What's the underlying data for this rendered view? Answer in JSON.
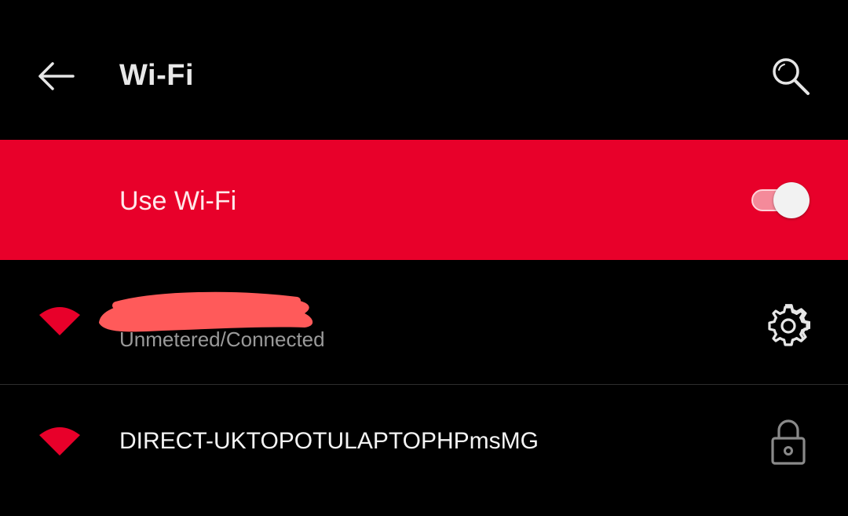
{
  "header": {
    "title": "Wi-Fi",
    "back_icon": "arrow-left-icon",
    "search_icon": "search-icon"
  },
  "master_switch": {
    "label": "Use Wi-Fi",
    "enabled": true
  },
  "networks": [
    {
      "name": "",
      "name_redacted": true,
      "status": "Unmetered/Connected",
      "signal_icon": "wifi-signal-icon",
      "action_icon": "gear-icon",
      "connected": true
    },
    {
      "name": "DIRECT-UKTOPOTULAPTOPHPmsMG",
      "status": "",
      "signal_icon": "wifi-signal-icon",
      "action_icon": "lock-icon",
      "secured": true
    }
  ],
  "colors": {
    "background": "#000000",
    "accent": "#e8002a",
    "title_text": "#e8e8e8",
    "secondary_text": "#9a9a9a",
    "redaction": "#ff5a5a",
    "icon": "#e6e6e6"
  }
}
